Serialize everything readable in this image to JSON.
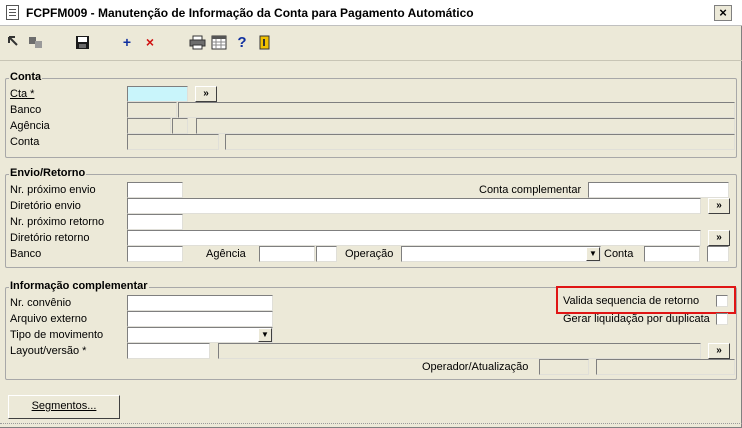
{
  "window": {
    "title": "FCPFM009 - Manutenção de Informação da Conta para Pagamento Automático",
    "close": "×"
  },
  "toolbar": {
    "icons": [
      "expand-icon",
      "link-icon",
      "save-icon",
      "add-icon",
      "delete-icon",
      "print-icon",
      "calendar-icon",
      "help-icon",
      "exit-icon"
    ],
    "add": "+",
    "delete": "×",
    "help": "?"
  },
  "conta": {
    "title": "Conta",
    "cta_label": "Cta *",
    "banco_label": "Banco",
    "agencia_label": "Agência",
    "conta_label": "Conta",
    "more": "»"
  },
  "envio": {
    "title": "Envio/Retorno",
    "nr_envio_label": "Nr. próximo envio",
    "conta_compl_label": "Conta complementar",
    "dir_envio_label": "Diretório envio",
    "nr_retorno_label": "Nr. próximo retorno",
    "dir_retorno_label": "Diretório retorno",
    "banco_label": "Banco",
    "agencia_label": "Agência",
    "operacao_label": "Operação",
    "conta_label": "Conta",
    "more": "»"
  },
  "info": {
    "title": "Informação complementar",
    "nr_convenio_label": "Nr. convênio",
    "arquivo_label": "Arquivo externo",
    "tipo_mov_label": "Tipo de movimento",
    "layout_label": "Layout/versão *",
    "valida_label": "Valida sequencia de retorno",
    "gerar_label": "Gerar liquidação por duplicata",
    "operador_label": "Operador/Atualização",
    "more": "»"
  },
  "buttons": {
    "segmentos": "Segmentos..."
  }
}
